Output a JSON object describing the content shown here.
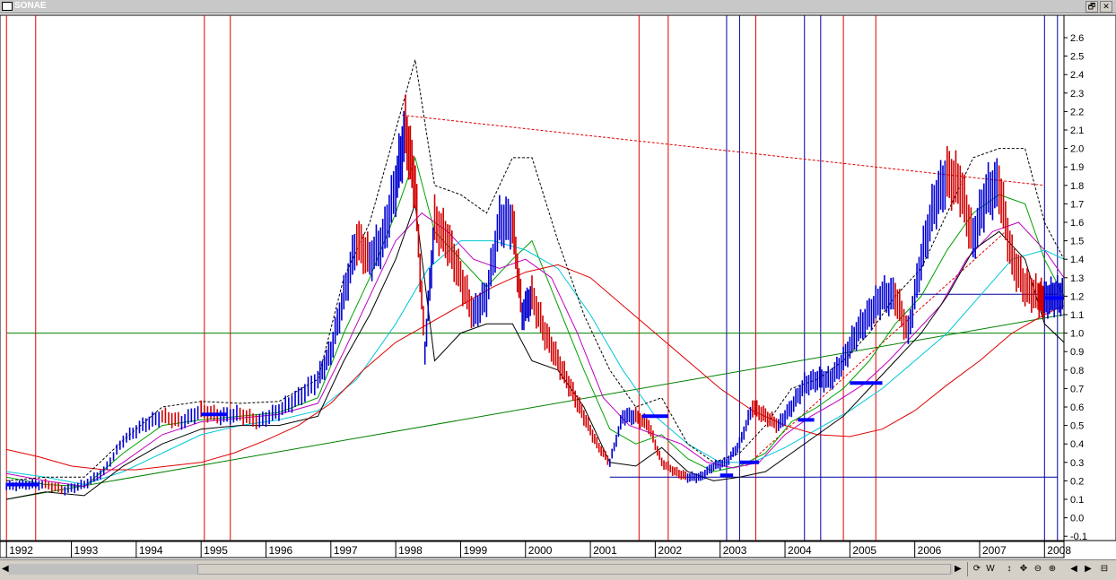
{
  "window": {
    "title": "SONAE",
    "restore_glyph": "🗗",
    "close_glyph": "✕"
  },
  "toolbar": {
    "scroll_left": "◀",
    "scroll_right": "▶",
    "tools": [
      "⟳",
      "W",
      "↕",
      "✥",
      "⊖",
      "⊕",
      "◀",
      "▶",
      "⊟"
    ]
  },
  "chart_data": {
    "type": "candlestick-line",
    "title": "",
    "xlabel": "",
    "ylabel": "",
    "x_range": [
      1992.0,
      2008.3
    ],
    "ylim": [
      -0.1,
      2.65
    ],
    "y_ticks": [
      "2.6",
      "2.5",
      "2.4",
      "2.3",
      "2.2",
      "2.1",
      "2.0",
      "1.9",
      "1.8",
      "1.7",
      "1.6",
      "1.5",
      "1.4",
      "1.3",
      "1.2",
      "1.1",
      "1.0",
      "0.9",
      "0.8",
      "0.7",
      "0.6",
      "0.5",
      "0.4",
      "0.3",
      "0.2",
      "0.1",
      "0.0",
      "-0.1"
    ],
    "y_tick_values": [
      2.6,
      2.5,
      2.4,
      2.3,
      2.2,
      2.1,
      2.0,
      1.9,
      1.8,
      1.7,
      1.6,
      1.5,
      1.4,
      1.3,
      1.2,
      1.1,
      1.0,
      0.9,
      0.8,
      0.7,
      0.6,
      0.5,
      0.4,
      0.3,
      0.2,
      0.1,
      0.0,
      -0.1
    ],
    "x_ticks": [
      "1992",
      "1993",
      "1994",
      "1995",
      "1996",
      "1997",
      "1998",
      "1999",
      "2000",
      "2001",
      "2002",
      "2003",
      "2004",
      "2005",
      "2006",
      "2007",
      "2008"
    ],
    "x_tick_values": [
      1992,
      1993,
      1994,
      1995,
      1996,
      1997,
      1998,
      1999,
      2000,
      2001,
      2002,
      2003,
      2004,
      2005,
      2006,
      2007,
      2008
    ],
    "price": {
      "x": [
        1992.0,
        1992.3,
        1992.6,
        1992.9,
        1993.2,
        1993.5,
        1993.8,
        1994.1,
        1994.4,
        1994.7,
        1995.0,
        1995.3,
        1995.6,
        1995.9,
        1996.2,
        1996.5,
        1996.8,
        1997.0,
        1997.2,
        1997.4,
        1997.6,
        1997.8,
        1998.0,
        1998.15,
        1998.3,
        1998.45,
        1998.6,
        1998.8,
        1999.0,
        1999.2,
        1999.4,
        1999.6,
        1999.8,
        1999.95,
        2000.1,
        2000.3,
        2000.5,
        2000.7,
        2000.9,
        2001.1,
        2001.3,
        2001.5,
        2001.7,
        2001.9,
        2002.1,
        2002.3,
        2002.5,
        2002.7,
        2002.9,
        2003.1,
        2003.3,
        2003.5,
        2003.7,
        2003.9,
        2004.1,
        2004.3,
        2004.5,
        2004.7,
        2004.9,
        2005.1,
        2005.3,
        2005.5,
        2005.7,
        2005.9,
        2006.1,
        2006.3,
        2006.5,
        2006.7,
        2006.9,
        2007.1,
        2007.3,
        2007.5,
        2007.7,
        2007.9,
        2008.0,
        2008.15,
        2008.3
      ],
      "y": [
        0.17,
        0.18,
        0.18,
        0.15,
        0.18,
        0.25,
        0.42,
        0.5,
        0.55,
        0.52,
        0.58,
        0.55,
        0.56,
        0.52,
        0.58,
        0.65,
        0.75,
        0.9,
        1.2,
        1.5,
        1.4,
        1.5,
        1.8,
        2.1,
        1.8,
        0.9,
        1.6,
        1.5,
        1.3,
        1.1,
        1.2,
        1.6,
        1.6,
        1.1,
        1.2,
        1.0,
        0.85,
        0.7,
        0.55,
        0.4,
        0.3,
        0.55,
        0.55,
        0.5,
        0.3,
        0.25,
        0.22,
        0.22,
        0.28,
        0.3,
        0.4,
        0.6,
        0.55,
        0.5,
        0.6,
        0.72,
        0.75,
        0.75,
        0.85,
        1.0,
        1.1,
        1.2,
        1.2,
        1.0,
        1.4,
        1.7,
        1.85,
        1.8,
        1.5,
        1.75,
        1.8,
        1.4,
        1.25,
        1.2,
        1.18,
        1.2,
        1.2
      ]
    },
    "series": [
      {
        "color": "#00a000",
        "x": [
          1992.0,
          1992.6,
          1993.2,
          1993.8,
          1994.4,
          1995.0,
          1995.6,
          1996.2,
          1996.8,
          1997.2,
          1997.6,
          1998.0,
          1998.3,
          1998.6,
          1999.0,
          1999.4,
          1999.8,
          2000.1,
          2000.5,
          2000.9,
          2001.3,
          2001.7,
          2002.1,
          2002.5,
          2002.9,
          2003.3,
          2003.7,
          2004.1,
          2004.5,
          2004.9,
          2005.3,
          2005.7,
          2006.1,
          2006.5,
          2006.9,
          2007.3,
          2007.7,
          2008.0,
          2008.3
        ],
        "y": [
          0.22,
          0.18,
          0.17,
          0.35,
          0.5,
          0.53,
          0.55,
          0.57,
          0.65,
          1.0,
          1.3,
          1.65,
          1.95,
          1.55,
          1.4,
          1.25,
          1.4,
          1.5,
          1.15,
          0.8,
          0.48,
          0.4,
          0.45,
          0.32,
          0.25,
          0.28,
          0.35,
          0.52,
          0.6,
          0.7,
          0.85,
          1.05,
          1.2,
          1.45,
          1.65,
          1.75,
          1.7,
          1.4,
          1.2
        ]
      },
      {
        "color": "#c000c0",
        "x": [
          1992.0,
          1992.6,
          1993.2,
          1993.8,
          1994.4,
          1995.0,
          1995.6,
          1996.2,
          1996.8,
          1997.2,
          1997.6,
          1998.0,
          1998.4,
          1998.8,
          1999.2,
          1999.6,
          2000.0,
          2000.4,
          2000.8,
          2001.2,
          2001.6,
          2002.0,
          2002.4,
          2002.8,
          2003.2,
          2003.6,
          2004.0,
          2004.4,
          2004.8,
          2005.2,
          2005.6,
          2006.0,
          2006.4,
          2006.8,
          2007.2,
          2007.6,
          2008.0,
          2008.3
        ],
        "y": [
          0.24,
          0.2,
          0.17,
          0.3,
          0.45,
          0.52,
          0.54,
          0.56,
          0.62,
          0.9,
          1.2,
          1.5,
          1.65,
          1.55,
          1.4,
          1.35,
          1.4,
          1.3,
          1.0,
          0.65,
          0.5,
          0.45,
          0.4,
          0.3,
          0.27,
          0.3,
          0.45,
          0.55,
          0.63,
          0.72,
          0.85,
          1.0,
          1.15,
          1.4,
          1.55,
          1.6,
          1.45,
          1.3
        ]
      },
      {
        "color": "#00c8d8",
        "x": [
          1992.0,
          1992.6,
          1993.2,
          1993.8,
          1994.4,
          1995.0,
          1995.6,
          1996.2,
          1996.8,
          1997.4,
          1998.0,
          1998.5,
          1999.0,
          1999.5,
          2000.0,
          2000.5,
          2001.0,
          2001.5,
          2002.0,
          2002.5,
          2003.0,
          2003.5,
          2004.0,
          2004.5,
          2005.0,
          2005.5,
          2006.0,
          2006.5,
          2007.0,
          2007.5,
          2008.0,
          2008.3
        ],
        "y": [
          0.25,
          0.22,
          0.18,
          0.25,
          0.35,
          0.45,
          0.5,
          0.53,
          0.58,
          0.75,
          1.05,
          1.35,
          1.5,
          1.5,
          1.45,
          1.35,
          1.1,
          0.8,
          0.55,
          0.4,
          0.3,
          0.3,
          0.38,
          0.48,
          0.58,
          0.7,
          0.85,
          1.0,
          1.2,
          1.4,
          1.45,
          1.4
        ]
      },
      {
        "color": "#e00000",
        "x": [
          1992.0,
          1992.5,
          1993.0,
          1993.5,
          1994.0,
          1994.5,
          1995.0,
          1995.5,
          1996.0,
          1996.5,
          1997.0,
          1997.5,
          1998.0,
          1998.5,
          1999.0,
          1999.5,
          2000.0,
          2000.5,
          2001.0,
          2001.5,
          2002.0,
          2002.5,
          2003.0,
          2003.5,
          2004.0,
          2004.5,
          2005.0,
          2005.5,
          2006.0,
          2006.5,
          2007.0,
          2007.5,
          2008.0,
          2008.3
        ],
        "y": [
          0.37,
          0.33,
          0.28,
          0.26,
          0.26,
          0.28,
          0.3,
          0.35,
          0.42,
          0.5,
          0.62,
          0.8,
          0.95,
          1.05,
          1.15,
          1.25,
          1.33,
          1.37,
          1.3,
          1.15,
          1.0,
          0.85,
          0.7,
          0.58,
          0.5,
          0.45,
          0.44,
          0.48,
          0.58,
          0.72,
          0.85,
          1.0,
          1.1,
          1.15
        ]
      },
      {
        "color": "#000000",
        "x": [
          1992.0,
          1992.6,
          1993.2,
          1993.8,
          1994.4,
          1995.0,
          1995.6,
          1996.2,
          1996.8,
          1997.2,
          1997.6,
          1998.0,
          1998.3,
          1998.6,
          1999.0,
          1999.4,
          1999.8,
          2000.1,
          2000.5,
          2000.9,
          2001.3,
          2001.7,
          2002.1,
          2002.5,
          2002.9,
          2003.3,
          2003.7,
          2004.1,
          2004.5,
          2004.9,
          2005.3,
          2005.7,
          2006.1,
          2006.5,
          2006.9,
          2007.3,
          2007.7,
          2008.0,
          2008.3
        ],
        "y": [
          0.1,
          0.14,
          0.12,
          0.28,
          0.4,
          0.48,
          0.5,
          0.5,
          0.55,
          0.85,
          1.1,
          1.4,
          1.7,
          0.85,
          1.0,
          1.05,
          1.05,
          0.85,
          0.8,
          0.6,
          0.3,
          0.28,
          0.38,
          0.25,
          0.2,
          0.22,
          0.25,
          0.35,
          0.45,
          0.55,
          0.7,
          0.85,
          1.0,
          1.2,
          1.45,
          1.55,
          1.4,
          1.05,
          0.95
        ]
      },
      {
        "color": "#000000",
        "dash": true,
        "x": [
          1992.0,
          1992.6,
          1993.2,
          1993.8,
          1994.4,
          1995.0,
          1995.6,
          1996.2,
          1996.8,
          1997.2,
          1997.6,
          1998.0,
          1998.3,
          1998.6,
          1999.0,
          1999.4,
          1999.8,
          2000.1,
          2000.5,
          2000.9,
          2001.3,
          2001.7,
          2002.1,
          2002.5,
          2002.9,
          2003.3,
          2003.7,
          2004.1,
          2004.5,
          2004.9,
          2005.3,
          2005.7,
          2006.1,
          2006.5,
          2006.9,
          2007.3,
          2007.7,
          2008.0,
          2008.3
        ],
        "y": [
          0.2,
          0.22,
          0.22,
          0.42,
          0.6,
          0.63,
          0.62,
          0.63,
          0.75,
          1.3,
          1.6,
          2.1,
          2.48,
          1.8,
          1.75,
          1.65,
          1.95,
          1.95,
          1.5,
          1.1,
          0.8,
          0.6,
          0.65,
          0.4,
          0.3,
          0.35,
          0.5,
          0.7,
          0.75,
          0.85,
          1.0,
          1.2,
          1.35,
          1.65,
          1.95,
          2.0,
          2.0,
          1.6,
          1.4
        ]
      }
    ],
    "trendlines": [
      {
        "color": "#008000",
        "x": [
          1992.0,
          2008.3
        ],
        "y": [
          0.1,
          1.1
        ]
      },
      {
        "color": "#008000",
        "x": [
          1992.0,
          2008.3
        ],
        "y": [
          1.0,
          1.0
        ]
      },
      {
        "color": "#e00000",
        "dash": true,
        "x": [
          1998.1,
          2008.0
        ],
        "y": [
          2.18,
          1.8
        ]
      },
      {
        "color": "#e00000",
        "dash": true,
        "x": [
          2003.4,
          2007.4
        ],
        "y": [
          0.28,
          1.55
        ]
      },
      {
        "color": "#0000a0",
        "x": [
          2001.3,
          2008.2
        ],
        "y": [
          0.22,
          0.22
        ]
      },
      {
        "color": "#0000a0",
        "x": [
          2006.0,
          2008.2
        ],
        "y": [
          1.21,
          1.21
        ]
      }
    ],
    "horizontal_bars": [
      {
        "x0": 1992.0,
        "x1": 1992.5,
        "y": 0.18
      },
      {
        "x0": 1995.0,
        "x1": 1995.4,
        "y": 0.56
      },
      {
        "x0": 2001.8,
        "x1": 2002.2,
        "y": 0.55
      },
      {
        "x0": 2003.0,
        "x1": 2003.2,
        "y": 0.23
      },
      {
        "x0": 2003.3,
        "x1": 2003.6,
        "y": 0.3
      },
      {
        "x0": 2004.2,
        "x1": 2004.45,
        "y": 0.53
      },
      {
        "x0": 2005.0,
        "x1": 2005.5,
        "y": 0.73
      },
      {
        "x0": 2008.0,
        "x1": 2008.3,
        "y": 1.19
      }
    ],
    "vlines_red": [
      1992.0,
      1992.45,
      1995.05,
      1995.45,
      2001.75,
      2002.2,
      2003.55,
      2004.9,
      2005.4
    ],
    "vlines_blue": [
      2003.1,
      2003.3,
      2004.3,
      2004.55,
      2008.0,
      2008.2
    ],
    "grid": false,
    "legend": "none"
  }
}
